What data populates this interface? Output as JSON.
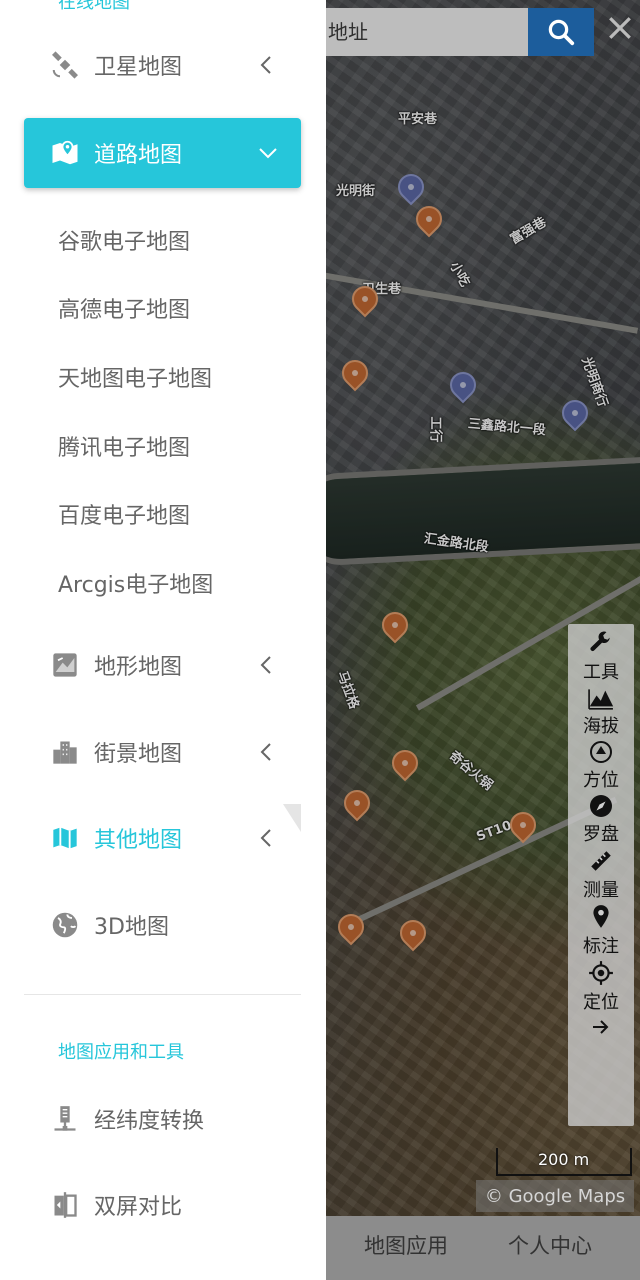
{
  "search": {
    "placeholder": "地址"
  },
  "drawer": {
    "top_label": "在线地图",
    "menu": [
      {
        "label": "卫星地图",
        "icon": "satellite-icon"
      },
      {
        "label": "道路地图",
        "icon": "map-pin-icon",
        "expanded": true
      },
      {
        "label": "地形地图",
        "icon": "terrain-icon"
      },
      {
        "label": "街景地图",
        "icon": "buildings-icon"
      },
      {
        "label": "其他地图",
        "icon": "folded-map-icon"
      },
      {
        "label": "3D地图",
        "icon": "globe-icon"
      }
    ],
    "road_submenu": [
      "谷歌电子地图",
      "高德电子地图",
      "天地图电子地图",
      "腾讯电子地图",
      "百度电子地图",
      "Arcgis电子地图"
    ],
    "section_header": "地图应用和工具",
    "tools": [
      {
        "label": "经纬度转换",
        "icon": "server-icon"
      },
      {
        "label": "双屏对比",
        "icon": "split-screen-icon"
      }
    ]
  },
  "map": {
    "streets": [
      "平安巷",
      "光明街",
      "卫生巷",
      "富强巷",
      "小吃",
      "工行",
      "三鑫路北一段",
      "光明商行",
      "汇金路北段",
      "马拉格",
      "奇谷火锅",
      "ST10"
    ],
    "tools": [
      {
        "label": "工具",
        "icon": "wrench-icon"
      },
      {
        "label": "海拔",
        "icon": "elevation-icon"
      },
      {
        "label": "方位",
        "icon": "direction-icon"
      },
      {
        "label": "罗盘",
        "icon": "compass-icon"
      },
      {
        "label": "测量",
        "icon": "ruler-icon"
      },
      {
        "label": "标注",
        "icon": "location-marker-icon"
      },
      {
        "label": "定位",
        "icon": "crosshair-icon"
      }
    ],
    "scale": "200 m",
    "attribution": "© Google Maps"
  },
  "bottom_nav": [
    "地图应用",
    "个人中心"
  ],
  "colors": {
    "accent": "#26c6da",
    "search_button": "#1c5d9c",
    "text_gray": "#666666"
  }
}
